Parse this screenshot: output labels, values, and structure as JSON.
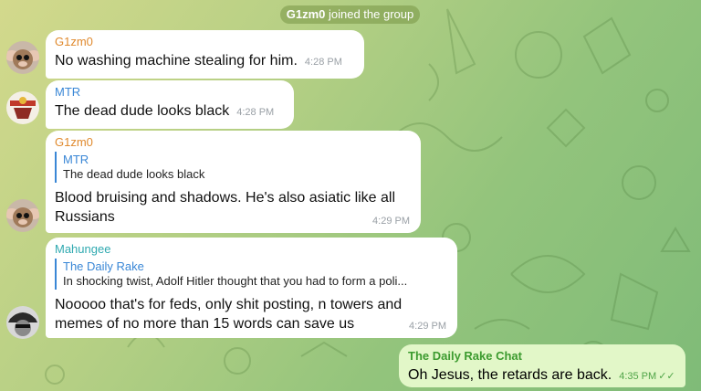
{
  "system": {
    "user": "G1zm0",
    "text": "joined the group"
  },
  "messages": [
    {
      "sender": "G1zm0",
      "sender_color": "#e08a2e",
      "text": "No washing machine stealing for him.",
      "time": "4:28 PM",
      "avatar": "gizmo-avatar"
    },
    {
      "sender": "MTR",
      "sender_color": "#3a87d6",
      "text": "The dead dude looks black",
      "time": "4:28 PM",
      "avatar": "mtr-avatar"
    },
    {
      "sender": "G1zm0",
      "sender_color": "#e08a2e",
      "reply_name": "MTR",
      "reply_text": "The dead dude looks black",
      "text_line1": "Blood bruising and shadows. He's also asiatic like all",
      "text_line2": "Russians",
      "time": "4:29 PM",
      "avatar": "gizmo-avatar"
    },
    {
      "sender": "Mahungee",
      "sender_color": "#2fa9b0",
      "reply_name": "The Daily Rake",
      "reply_text": "In shocking twist, Adolf Hitler thought that you had to form a poli...",
      "text_line1": "Nooooo that's for feds, only shit posting, n towers and",
      "text_line2": "memes of no more than 15 words can save us",
      "time": "4:29 PM",
      "avatar": "mahungee-avatar"
    },
    {
      "sender": "The Daily Rake Chat",
      "text": "Oh Jesus, the retards are back.",
      "time": "4:35 PM",
      "status": "read"
    }
  ]
}
